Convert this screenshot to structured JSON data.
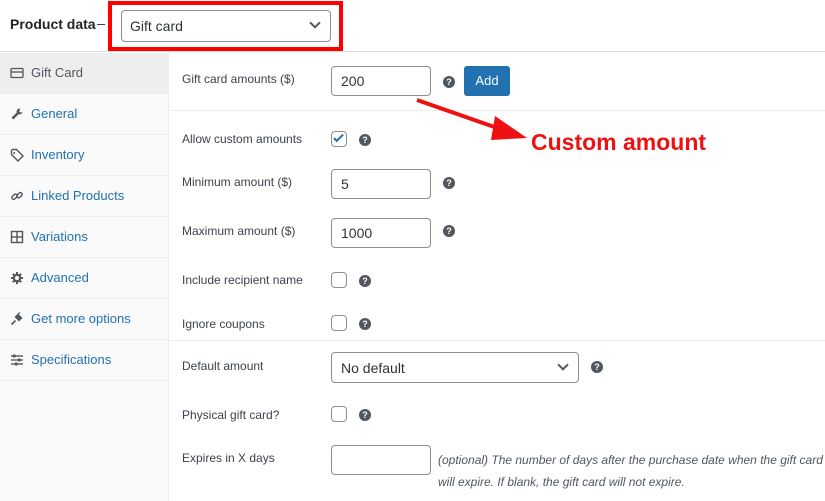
{
  "header": {
    "title": "Product data",
    "product_type": "Gift card"
  },
  "sidebar": {
    "items": [
      {
        "label": "Gift Card",
        "icon": "gift-card-icon",
        "active": true
      },
      {
        "label": "General",
        "icon": "wrench-icon"
      },
      {
        "label": "Inventory",
        "icon": "tag-icon"
      },
      {
        "label": "Linked Products",
        "icon": "link-icon"
      },
      {
        "label": "Variations",
        "icon": "grid-icon"
      },
      {
        "label": "Advanced",
        "icon": "gear-icon"
      },
      {
        "label": "Get more options",
        "icon": "plug-icon"
      },
      {
        "label": "Specifications",
        "icon": "sliders-icon"
      }
    ]
  },
  "form": {
    "amounts_label": "Gift card amounts ($)",
    "amounts_value": "200",
    "add_label": "Add",
    "allow_custom_label": "Allow custom amounts",
    "allow_custom_checked": true,
    "min_label": "Minimum amount ($)",
    "min_value": "5",
    "max_label": "Maximum amount ($)",
    "max_value": "1000",
    "recipient_label": "Include recipient name",
    "recipient_checked": false,
    "ignore_coupons_label": "Ignore coupons",
    "ignore_coupons_checked": false,
    "default_amount_label": "Default amount",
    "default_amount_value": "No default",
    "physical_label": "Physical gift card?",
    "physical_checked": false,
    "expires_label": "Expires in X days",
    "expires_value": "",
    "expires_help_prefix": "(optional)",
    "expires_help_text": " The number of days after the purchase date when the gift card will expire. If blank, the gift card will not expire.",
    "help_glyph": "?"
  },
  "annotation": {
    "text": "Custom amount",
    "color": "#ee1111"
  },
  "colors": {
    "accent": "#2271b1",
    "highlight": "#ff0000"
  }
}
